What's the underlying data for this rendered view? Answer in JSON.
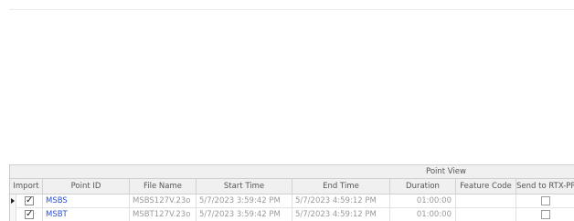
{
  "grid": {
    "group_header": "Point View",
    "columns": [
      "Import",
      "Point ID",
      "File Name",
      "Start Time",
      "End Time",
      "Duration",
      "Feature Code",
      "Send to RTX-PP"
    ],
    "rows": [
      {
        "import": true,
        "point_id": "MSBS",
        "file_name": "MSBS127V.23o",
        "start_time": "5/7/2023 3:59:42 PM",
        "end_time": "5/7/2023 4:59:12 PM",
        "duration": "01:00:00",
        "feature_code": "",
        "send_to_rtx_pp": false,
        "current": true
      },
      {
        "import": true,
        "point_id": "MSBT",
        "file_name": "MSBT127V.23o",
        "start_time": "5/7/2023 3:59:42 PM",
        "end_time": "5/7/2023 4:59:12 PM",
        "duration": "01:00:00",
        "feature_code": "",
        "send_to_rtx_pp": false,
        "current": false
      }
    ]
  }
}
